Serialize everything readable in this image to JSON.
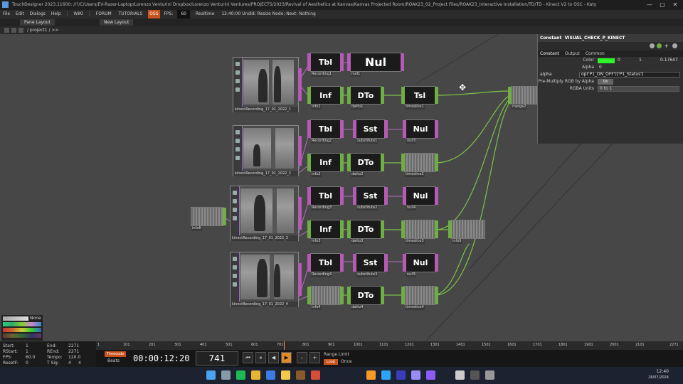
{
  "window": {
    "title": "TouchDesigner 2023.11600: //?/C/Users/EV-Razer-Laptop/Lorenzo Venturini Dropbox/Lorenzo Venturini Ventures/PROJECTS/2023/Revival of Aesthetics at Kanvas/Kanvas Projected Room/ROAK23_02_Project Files/ROAK23_Interactive Installation/TD/TD - Kinect V2 to OSC - Katy",
    "minimize": "—",
    "maximize": "▢",
    "close": "✕"
  },
  "menu": {
    "items": [
      "File",
      "Edit",
      "Dialogs",
      "Help"
    ],
    "wiki": "WIKI",
    "forum": "FORUM",
    "tutorials": "TUTORIALS",
    "badge": "OSS",
    "fps_label": "FPS:",
    "fps_value": "60",
    "realtime": "Realtime",
    "status": "12:40:00 Undid: Resize Node; Next: Nothing"
  },
  "pane": {
    "pane_layout": "Pane Layout",
    "new_layout": "New Layout"
  },
  "path": {
    "text": "/ project1 / >>"
  },
  "nodes": {
    "tbl1": {
      "big": "Tbl",
      "label": "Recording1"
    },
    "null1": {
      "big": "Nul",
      "label": "null1"
    },
    "info1": {
      "big": "Inf",
      "label": "info1"
    },
    "dto1": {
      "big": "DTo",
      "label": "datto1"
    },
    "tsl1": {
      "big": "Tsl",
      "label": "timeslice1"
    },
    "merge2": {
      "label": "merge2"
    },
    "tbl2": {
      "big": "Tbl",
      "label": "Recording2"
    },
    "sst1": {
      "big": "Sst",
      "label": "substitute1"
    },
    "nul3": {
      "big": "Nul",
      "label": "null3"
    },
    "info2": {
      "big": "Inf",
      "label": "info2"
    },
    "dto2": {
      "big": "DTo",
      "label": "datto2"
    },
    "tsl2": {
      "label": "timeslice2"
    },
    "tbl3": {
      "big": "Tbl",
      "label": "Recording3"
    },
    "sst2": {
      "big": "Sst",
      "label": "substitute2"
    },
    "nul4": {
      "big": "Nul",
      "label": "null4"
    },
    "info3": {
      "big": "Inf",
      "label": "info3"
    },
    "dto3": {
      "big": "DTo",
      "label": "datto3"
    },
    "tsl3": {
      "label": "timeslice3"
    },
    "info5": {
      "label": "info5"
    },
    "tbl4": {
      "big": "Tbl",
      "label": "Recording4"
    },
    "sst3": {
      "big": "Sst",
      "label": "substitute3"
    },
    "nul5": {
      "big": "Nul",
      "label": "null5"
    },
    "info4": {
      "label": "info4"
    },
    "dto4": {
      "big": "DTo",
      "label": "datto4"
    },
    "tsl4": {
      "label": "timeslice4"
    },
    "info6": {
      "label": "info6"
    },
    "kin1": {
      "label": "kinectRecording_17_01_2022_1"
    },
    "kin2": {
      "label": "kinectRecording_17_01_2022_2"
    },
    "kin3": {
      "label": "kinectRecording_17_01_2022_3"
    },
    "kin4": {
      "label": "kinectRecording_17_01_2022_4"
    }
  },
  "params": {
    "op_type": "Constant",
    "op_name": "VISUAL_CHECK_P_KINECT",
    "tabs": [
      "Constant",
      "Output",
      "Common"
    ],
    "color_label": "Color",
    "color_swatch": "#2cf52c",
    "color_r": "0",
    "color_g": "1",
    "color_b": "0.17647",
    "alpha_label": "Alpha",
    "alpha_value": "0",
    "alpha_row_name": "alpha",
    "alpha_expr": "op('P1_ON_OFF')['P1_Status']",
    "premult_label": "Pre-Multiply RGB by Alpha",
    "premult_value": "On",
    "rgba_label": "RGBA Units",
    "rgba_value": "0 to 1"
  },
  "palette": {
    "none": "None"
  },
  "stats": {
    "start_label": "Start:",
    "start": "1",
    "end_label": "End:",
    "end": "2271",
    "rstart_label": "RStart:",
    "rstart": "1",
    "rend_label": "REnd:",
    "rend": "2271",
    "fps_label": "FPS:",
    "fps": "60.0",
    "tempo_label": "Tempo:",
    "tempo": "120.0",
    "resetf_label": "ResetF:",
    "resetf": "0",
    "tsig_label": "T Sig:",
    "tsig_a": "4",
    "tsig_b": "4"
  },
  "ruler": {
    "ticks": [
      "1",
      "101",
      "201",
      "301",
      "401",
      "501",
      "601",
      "701",
      "801",
      "901",
      "1001",
      "1101",
      "1201",
      "1301",
      "1401",
      "1501",
      "1601",
      "1701",
      "1801",
      "1901",
      "2001",
      "2101",
      "2271"
    ]
  },
  "timeline": {
    "timecode_btn": "Timecode",
    "beats_btn": "Beats",
    "timecode": "00:00:12:20",
    "frame": "741",
    "range_limit": "Range Limit",
    "loop": "Loop",
    "once": "Once",
    "controls": [
      "⏮",
      "⏸",
      "◀",
      "▶",
      "–",
      "+"
    ]
  },
  "taskbar": {
    "time": "12:40",
    "date": "26/07/2024",
    "icons": [
      {
        "name": "windows-icon",
        "color": "#4aa3f0"
      },
      {
        "name": "search-icon",
        "color": "#8899aa"
      },
      {
        "name": "spotify-icon",
        "color": "#1db954"
      },
      {
        "name": "chrome-icon",
        "color": "#e8b533"
      },
      {
        "name": "photos-icon",
        "color": "#3b7de0"
      },
      {
        "name": "explorer-icon",
        "color": "#f2c94c"
      },
      {
        "name": "touchdesigner-icon",
        "color": "#8a5a2b"
      },
      {
        "name": "app-icon",
        "color": "#d94c3a"
      },
      {
        "name": "illustrator-icon",
        "color": "#f79a2a"
      },
      {
        "name": "photoshop-icon",
        "color": "#2fa3f5"
      },
      {
        "name": "media-encoder-icon",
        "color": "#3b3bbd"
      },
      {
        "name": "after-effects-icon",
        "color": "#9a8cf5"
      },
      {
        "name": "premiere-icon",
        "color": "#8b5cf6"
      },
      {
        "name": "obs-icon",
        "color": "#cccccc"
      },
      {
        "name": "camera-icon",
        "color": "#555555"
      },
      {
        "name": "settings-icon",
        "color": "#999999"
      }
    ]
  }
}
